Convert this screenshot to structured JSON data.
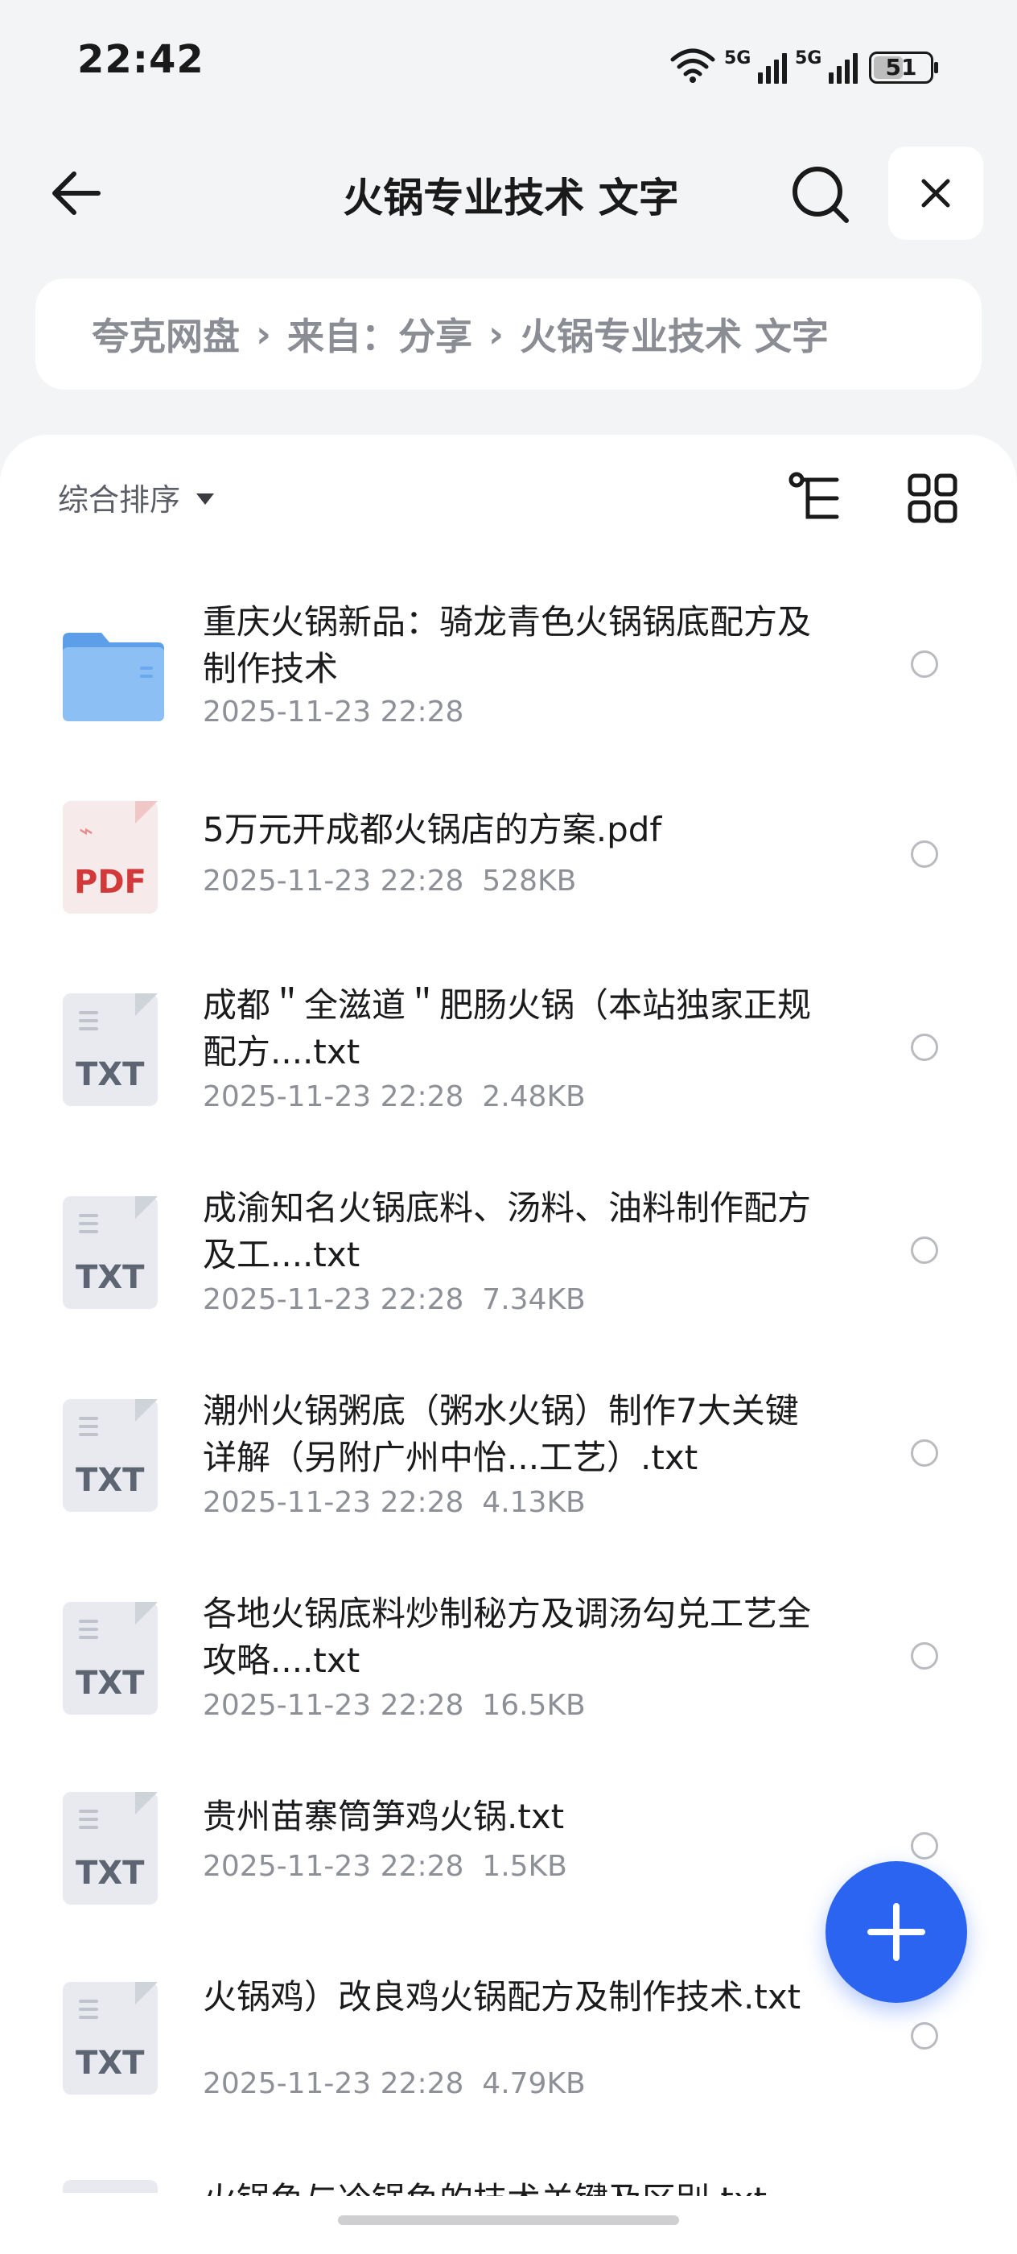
{
  "status_bar": {
    "time": "22:42",
    "battery": "51",
    "net1": "5G",
    "net2": "5G"
  },
  "header": {
    "title": "火锅专业技术 文字"
  },
  "breadcrumb": {
    "items": [
      "夸克网盘",
      "来自：分享",
      "火锅专业技术 文字"
    ]
  },
  "toolbar": {
    "sort_label": "综合排序"
  },
  "files": [
    {
      "name": "重庆火锅新品：骑龙青色火锅锅底配方及制作技术",
      "date": "2025-11-23 22:28",
      "size": "",
      "type": "folder"
    },
    {
      "name": "5万元开成都火锅店的方案.pdf",
      "date": "2025-11-23 22:28",
      "size": "528KB",
      "type": "pdf"
    },
    {
      "name": "成都＂全滋道＂肥肠火锅（本站独家正规配方....txt",
      "date": "2025-11-23 22:28",
      "size": "2.48KB",
      "type": "txt"
    },
    {
      "name": "成渝知名火锅底料、汤料、油料制作配方及工....txt",
      "date": "2025-11-23 22:28",
      "size": "7.34KB",
      "type": "txt"
    },
    {
      "name": "潮州火锅粥底（粥水火锅）制作7大关键详解（另附广州中怡...工艺）.txt",
      "date": "2025-11-23 22:28",
      "size": "4.13KB",
      "type": "txt"
    },
    {
      "name": "各地火锅底料炒制秘方及调汤勾兑工艺全攻略....txt",
      "date": "2025-11-23 22:28",
      "size": "16.5KB",
      "type": "txt"
    },
    {
      "name": "贵州苗寨筒笋鸡火锅.txt",
      "date": "2025-11-23 22:28",
      "size": "1.5KB",
      "type": "txt"
    },
    {
      "name": "火锅鸡）改良鸡火锅配方及制作技术.txt",
      "date": "2025-11-23 22:28",
      "size": "4.79KB",
      "type": "txt"
    }
  ],
  "partial_row": {
    "name": "火锅鱼与冷锅鱼的技术关键及区别.txt"
  },
  "icons": {
    "pdf_label": "PDF",
    "txt_label": "TXT"
  },
  "colors": {
    "accent": "#2a64f0",
    "folder": "#6aa8f0",
    "pdf_red": "#d23a3a"
  }
}
